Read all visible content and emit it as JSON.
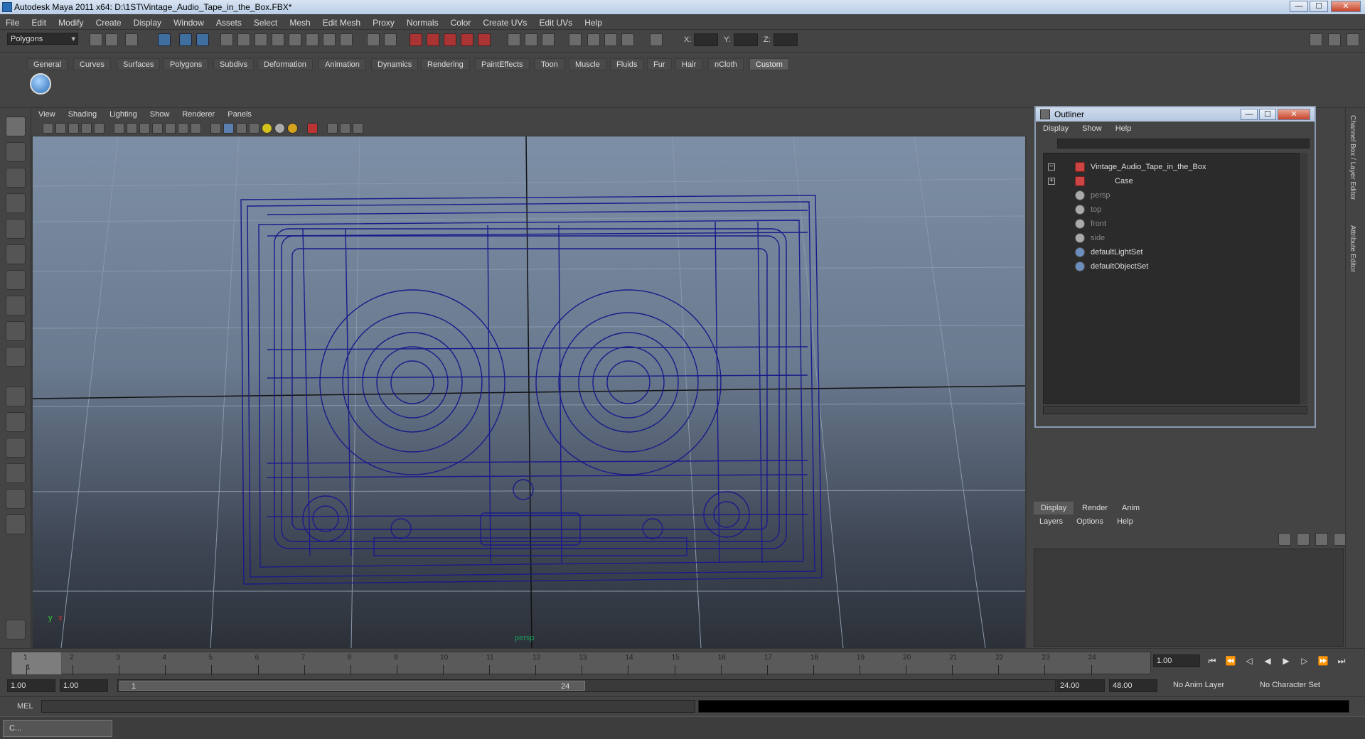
{
  "window": {
    "title": "Autodesk Maya 2011 x64: D:\\1ST\\Vintage_Audio_Tape_in_the_Box.FBX*",
    "minimize": "—",
    "maximize": "☐",
    "close": "✕"
  },
  "menubar": [
    "File",
    "Edit",
    "Modify",
    "Create",
    "Display",
    "Window",
    "Assets",
    "Select",
    "Mesh",
    "Edit Mesh",
    "Proxy",
    "Normals",
    "Color",
    "Create UVs",
    "Edit UVs",
    "Help"
  ],
  "statusline": {
    "mode": "Polygons",
    "coord_labels": [
      "X:",
      "Y:",
      "Z:"
    ]
  },
  "shelf": {
    "tabs": [
      "General",
      "Curves",
      "Surfaces",
      "Polygons",
      "Subdivs",
      "Deformation",
      "Animation",
      "Dynamics",
      "Rendering",
      "PaintEffects",
      "Toon",
      "Muscle",
      "Fluids",
      "Fur",
      "Hair",
      "nCloth",
      "Custom"
    ],
    "active_tab": "Custom"
  },
  "viewport": {
    "menu": [
      "View",
      "Shading",
      "Lighting",
      "Show",
      "Renderer",
      "Panels"
    ],
    "camera_label": "persp",
    "axis_x": "x",
    "axis_y": "y"
  },
  "outliner": {
    "title": "Outliner",
    "menu": [
      "Display",
      "Show",
      "Help"
    ],
    "items": [
      {
        "label": "Vintage_Audio_Tape_in_the_Box",
        "expander": "−",
        "dim": false
      },
      {
        "label": "Case",
        "expander": "+",
        "dim": false
      },
      {
        "label": "persp",
        "dim": true
      },
      {
        "label": "top",
        "dim": true
      },
      {
        "label": "front",
        "dim": true
      },
      {
        "label": "side",
        "dim": true
      },
      {
        "label": "defaultLightSet",
        "dim": false
      },
      {
        "label": "defaultObjectSet",
        "dim": false
      }
    ]
  },
  "layers": {
    "tabs": [
      "Display",
      "Render",
      "Anim"
    ],
    "active_tab": "Display",
    "menu": [
      "Layers",
      "Options",
      "Help"
    ]
  },
  "side_tabs": [
    "Channel Box / Layer Editor",
    "Attribute Editor"
  ],
  "timeline": {
    "ticks": [
      "1",
      "2",
      "3",
      "4",
      "5",
      "6",
      "7",
      "8",
      "9",
      "10",
      "11",
      "12",
      "13",
      "14",
      "15",
      "16",
      "17",
      "18",
      "19",
      "20",
      "21",
      "22",
      "23",
      "24"
    ],
    "current_frame": "1",
    "current_time": "1.00"
  },
  "range": {
    "start_time": "1.00",
    "playback_start": "1.00",
    "range_start_label": "1",
    "range_end_label": "24",
    "playback_end": "24.00",
    "end_time": "48.00",
    "anim_layer": "No Anim Layer",
    "character_set": "No Character Set"
  },
  "command": {
    "label": "MEL"
  },
  "taskbar": {
    "item": "C..."
  }
}
